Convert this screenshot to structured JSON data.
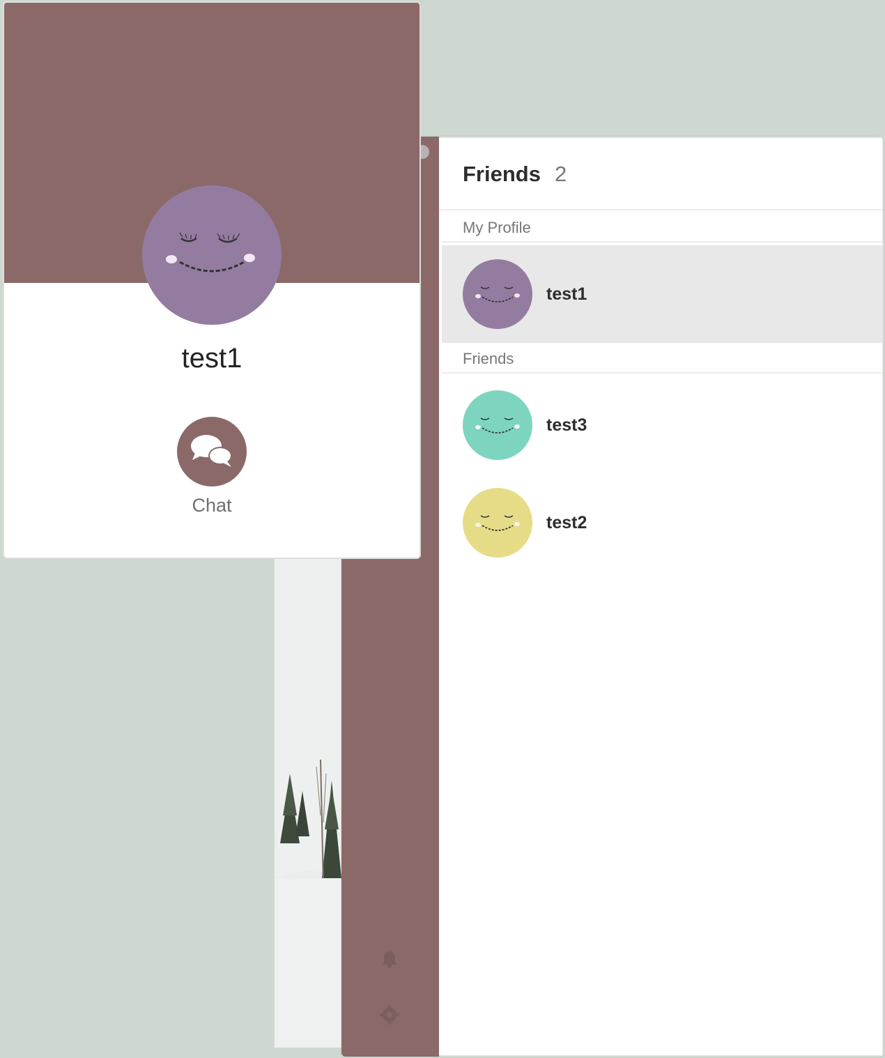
{
  "friends_panel": {
    "title": "Friends",
    "count": "2",
    "sections": {
      "my_profile_label": "My Profile",
      "friends_label": "Friends"
    },
    "my_profile": {
      "name": "test1",
      "avatar_color": "#947ca0"
    },
    "friends": [
      {
        "name": "test3",
        "avatar_color": "#7dd5c0"
      },
      {
        "name": "test2",
        "avatar_color": "#e6dc88"
      }
    ]
  },
  "profile_card": {
    "name": "test1",
    "avatar_color": "#947ca0",
    "banner_color": "#8b6969",
    "chat_label": "Chat",
    "chat_icon": "chat-bubbles-icon"
  },
  "side_nav": {
    "color": "#8b6969",
    "icons": [
      "bell-icon",
      "gear-icon"
    ]
  }
}
